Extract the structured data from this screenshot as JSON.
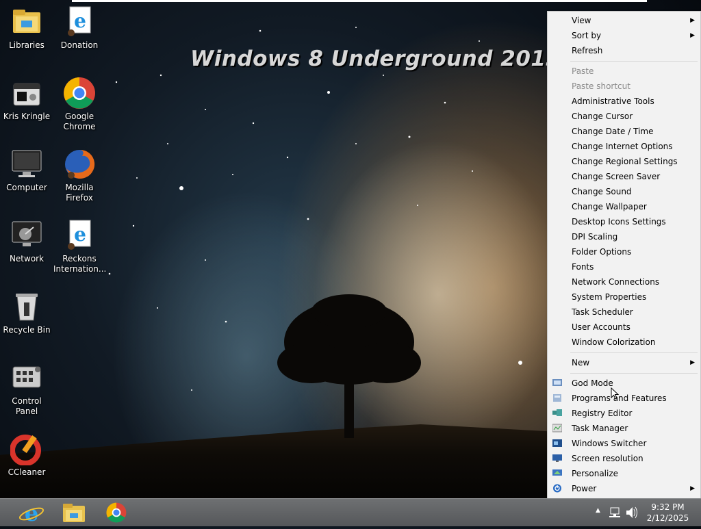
{
  "wallpaper": {
    "banner_text": "Windows 8 Underground 2013"
  },
  "desktop_icons": [
    {
      "label": "Libraries",
      "icon": "libraries-folder-icon"
    },
    {
      "label": "Donation",
      "icon": "internet-explorer-icon"
    },
    {
      "label": "Kris Kringle",
      "icon": "media-player-icon"
    },
    {
      "label": "Google Chrome",
      "icon": "chrome-icon"
    },
    {
      "label": "Computer",
      "icon": "computer-monitor-icon"
    },
    {
      "label": "Mozilla Firefox",
      "icon": "firefox-icon"
    },
    {
      "label": "Network",
      "icon": "network-icon"
    },
    {
      "label": "Reckons Internation...",
      "icon": "internet-explorer-icon"
    },
    {
      "label": "Recycle Bin",
      "icon": "recycle-bin-icon"
    },
    {
      "label": "Control Panel",
      "icon": "control-panel-icon"
    },
    {
      "label": "CCleaner",
      "icon": "ccleaner-icon"
    }
  ],
  "context_menu": {
    "items": [
      {
        "label": "View",
        "submenu": true
      },
      {
        "label": "Sort by",
        "submenu": true
      },
      {
        "label": "Refresh"
      },
      {
        "label": "Paste",
        "disabled": true
      },
      {
        "label": "Paste shortcut",
        "disabled": true
      },
      {
        "label": "Administrative Tools"
      },
      {
        "label": "Change Cursor"
      },
      {
        "label": "Change Date / Time"
      },
      {
        "label": "Change Internet Options"
      },
      {
        "label": "Change Regional Settings"
      },
      {
        "label": "Change Screen Saver"
      },
      {
        "label": "Change Sound"
      },
      {
        "label": "Change Wallpaper"
      },
      {
        "label": "Desktop Icons Settings"
      },
      {
        "label": "DPI Scaling"
      },
      {
        "label": "Folder Options"
      },
      {
        "label": "Fonts"
      },
      {
        "label": "Network Connections"
      },
      {
        "label": "System Properties"
      },
      {
        "label": "Task Scheduler"
      },
      {
        "label": "User Accounts"
      },
      {
        "label": "Window Colorization"
      },
      {
        "label": "New",
        "submenu": true
      },
      {
        "label": "God Mode",
        "icon": "god-mode-icon"
      },
      {
        "label": "Programs and Features",
        "icon": "programs-features-icon"
      },
      {
        "label": "Registry Editor",
        "icon": "registry-editor-icon"
      },
      {
        "label": "Task Manager",
        "icon": "task-manager-icon"
      },
      {
        "label": "Windows Switcher",
        "icon": "windows-switcher-icon"
      },
      {
        "label": "Screen resolution",
        "icon": "screen-resolution-icon"
      },
      {
        "label": "Personalize",
        "icon": "personalize-icon"
      },
      {
        "label": "Power",
        "icon": "power-icon",
        "submenu": true
      }
    ]
  },
  "taskbar": {
    "pinned": [
      {
        "name": "internet-explorer-icon"
      },
      {
        "name": "file-explorer-icon"
      },
      {
        "name": "chrome-icon"
      }
    ],
    "tray_icons": [
      "show-hidden-icons-arrow",
      "network-tray-icon",
      "volume-icon"
    ],
    "clock": {
      "time": "9:32 PM",
      "date": "2/12/2025"
    }
  },
  "colors": {
    "menu_bg": "#f2f2f2",
    "taskbar": "#5e6062",
    "disabled_text": "#8a8a8a"
  }
}
